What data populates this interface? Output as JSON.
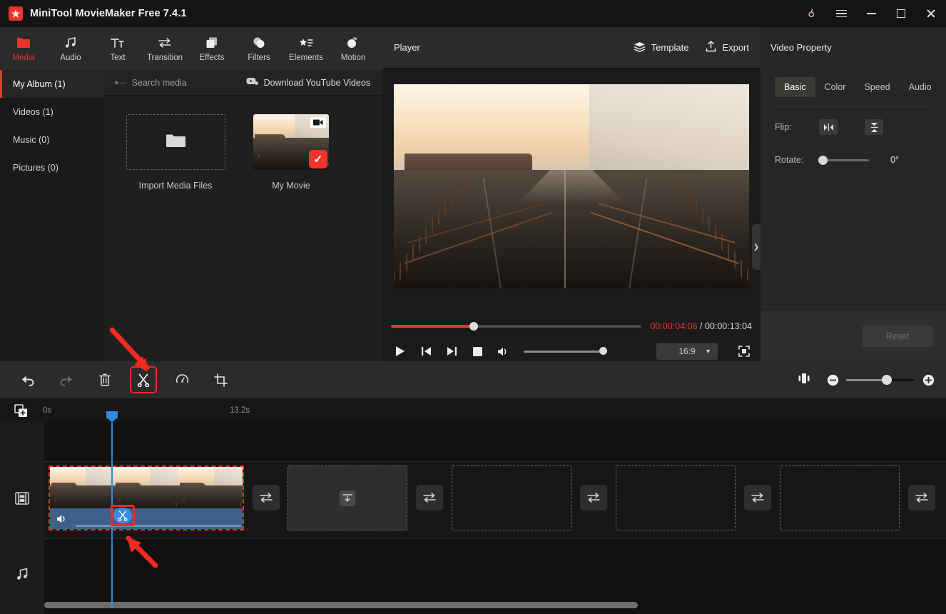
{
  "window": {
    "title": "MiniTool MovieMaker Free 7.4.1",
    "controls": {
      "key": "key-icon",
      "menu": "menu-icon",
      "minimize": "minimize",
      "maximize": "maximize",
      "close": "close"
    }
  },
  "tabs": [
    {
      "label": "Media",
      "icon": "media-icon",
      "active": true
    },
    {
      "label": "Audio",
      "icon": "audio-icon",
      "active": false
    },
    {
      "label": "Text",
      "icon": "text-icon",
      "active": false
    },
    {
      "label": "Transition",
      "icon": "transition-icon",
      "active": false
    },
    {
      "label": "Effects",
      "icon": "effects-icon",
      "active": false
    },
    {
      "label": "Filters",
      "icon": "filters-icon",
      "active": false
    },
    {
      "label": "Elements",
      "icon": "elements-icon",
      "active": false
    },
    {
      "label": "Motion",
      "icon": "motion-icon",
      "active": false
    }
  ],
  "media": {
    "categories": [
      {
        "label": "My Album (1)",
        "active": true
      },
      {
        "label": "Videos (1)",
        "active": false
      },
      {
        "label": "Music (0)",
        "active": false
      },
      {
        "label": "Pictures (0)",
        "active": false
      }
    ],
    "search_placeholder": "Search media",
    "search_value": "",
    "download_youtube": "Download YouTube Videos",
    "items": [
      {
        "label": "Import Media Files",
        "type": "import"
      },
      {
        "label": "My Movie",
        "type": "video",
        "selected": true
      }
    ]
  },
  "player": {
    "title": "Player",
    "template_label": "Template",
    "export_label": "Export",
    "current_time": "00:00:04:06",
    "separator": "/",
    "total_time": "00:00:13:04",
    "progress_percent": 33,
    "aspect_ratio": "16:9",
    "volume_percent": 100,
    "controls": [
      "play",
      "prev-frame",
      "next-frame",
      "stop",
      "volume",
      "fullscreen"
    ]
  },
  "property": {
    "title": "Video Property",
    "tabs": [
      {
        "label": "Basic",
        "active": true
      },
      {
        "label": "Color",
        "active": false
      },
      {
        "label": "Speed",
        "active": false
      },
      {
        "label": "Audio",
        "active": false
      }
    ],
    "flip_label": "Flip:",
    "rotate_label": "Rotate:",
    "rotate_value": "0°",
    "reset_label": "Reset"
  },
  "toolbar": {
    "buttons": [
      {
        "name": "undo",
        "disabled": false
      },
      {
        "name": "redo",
        "disabled": true
      },
      {
        "name": "delete",
        "disabled": false
      },
      {
        "name": "split",
        "disabled": false,
        "highlighted": true
      },
      {
        "name": "speed",
        "disabled": false
      },
      {
        "name": "crop",
        "disabled": false
      }
    ],
    "zoom_percent": 52
  },
  "timeline": {
    "add_media_icon": "add-media-icon",
    "ticks": [
      "0s",
      "13.2s"
    ],
    "tracks": [
      {
        "name": "overlay-track",
        "icon": ""
      },
      {
        "name": "video-track",
        "icon": "film-icon"
      },
      {
        "name": "audio-track",
        "icon": "music-icon"
      }
    ],
    "clip": {
      "name": "My Movie",
      "selected": true,
      "muted": false
    },
    "split_marker_icon": "scissors-icon",
    "transition_slots": 5,
    "drop_placeholders": 4
  },
  "colors": {
    "accent_red": "#e8352b",
    "highlight_red": "#f22a22",
    "playhead_blue": "#2f8ae0",
    "clip_audio_blue": "#3f6089",
    "panel_bg": "#2b2b2b",
    "window_bg": "#141414"
  }
}
